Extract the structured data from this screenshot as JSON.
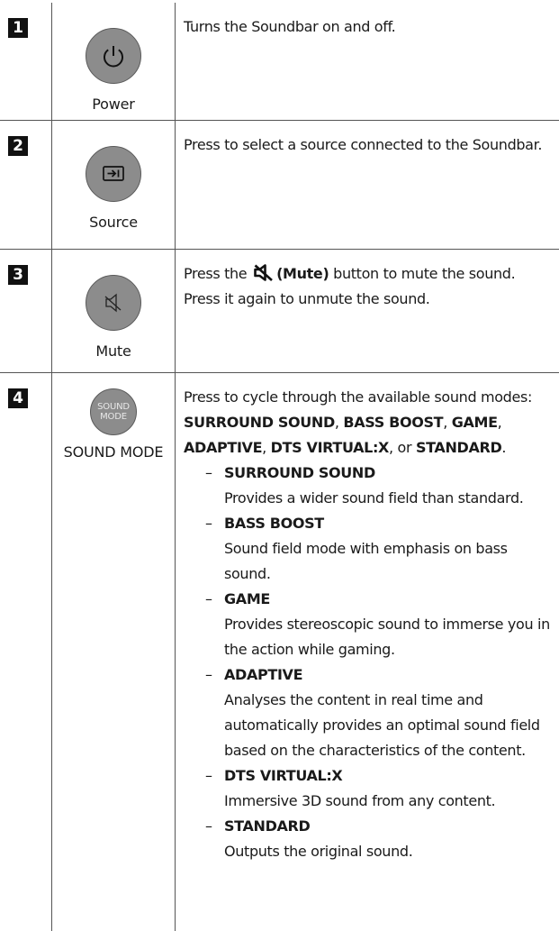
{
  "rows": [
    {
      "number": "1",
      "label": "Power",
      "icon": "power-icon",
      "description": "Turns the Soundbar on and off."
    },
    {
      "number": "2",
      "label": "Source",
      "icon": "source-icon",
      "description": "Press to select a source connected to the Soundbar."
    },
    {
      "number": "3",
      "label": "Mute",
      "icon": "mute-icon",
      "description_before": "Press the",
      "description_bold": "(Mute)",
      "description_after": "button to mute the sound.",
      "description_line2": "Press it again to unmute the sound."
    },
    {
      "number": "4",
      "label": "SOUND MODE",
      "button_text_line1": "SOUND",
      "button_text_line2": "MODE",
      "intro": "Press to cycle through the available sound modes:",
      "mode_list": {
        "m1": "SURROUND SOUND",
        "sep1": ", ",
        "m2": "BASS BOOST",
        "sep2": ", ",
        "m3": "GAME",
        "sep3": ",",
        "m4": "ADAPTIVE",
        "sep4": ", ",
        "m5": "DTS VIRTUAL:X",
        "sep5": ", or ",
        "m6": "STANDARD",
        "end": "."
      },
      "modes": [
        {
          "dash": "–",
          "name": "SURROUND SOUND",
          "description": "Provides a wider sound field than standard."
        },
        {
          "dash": "–",
          "name": "BASS BOOST",
          "description": "Sound field mode with emphasis on bass sound."
        },
        {
          "dash": "–",
          "name": "GAME",
          "description": "Provides stereoscopic sound to immerse you in the action while gaming."
        },
        {
          "dash": "–",
          "name": "ADAPTIVE",
          "description": "Analyses the content in real time and automatically provides an optimal sound field based on the characteristics of the content."
        },
        {
          "dash": "–",
          "name": "DTS VIRTUAL:X",
          "description": "Immersive 3D sound from any content."
        },
        {
          "dash": "–",
          "name": "STANDARD",
          "description": "Outputs the original sound."
        }
      ]
    }
  ],
  "colors": {
    "button_fill": "#8c8c8c",
    "number_badge": "#111111",
    "rule": "#555555"
  }
}
